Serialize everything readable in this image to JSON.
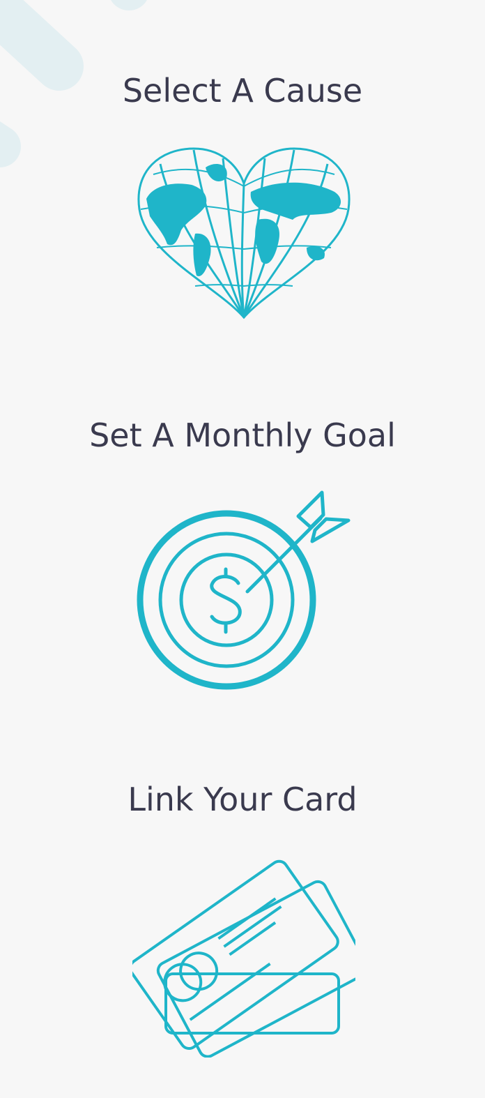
{
  "steps": [
    {
      "title": "Select A Cause",
      "icon": "heart-globe-icon"
    },
    {
      "title": "Set A Monthly Goal",
      "icon": "dollar-target-icon"
    },
    {
      "title": "Link Your Card",
      "icon": "credit-cards-icon"
    }
  ],
  "colors": {
    "background": "#f7f7f7",
    "accent": "#1fb5c9",
    "title_text": "#3a3a4e",
    "decoration": "#e3eff2"
  }
}
